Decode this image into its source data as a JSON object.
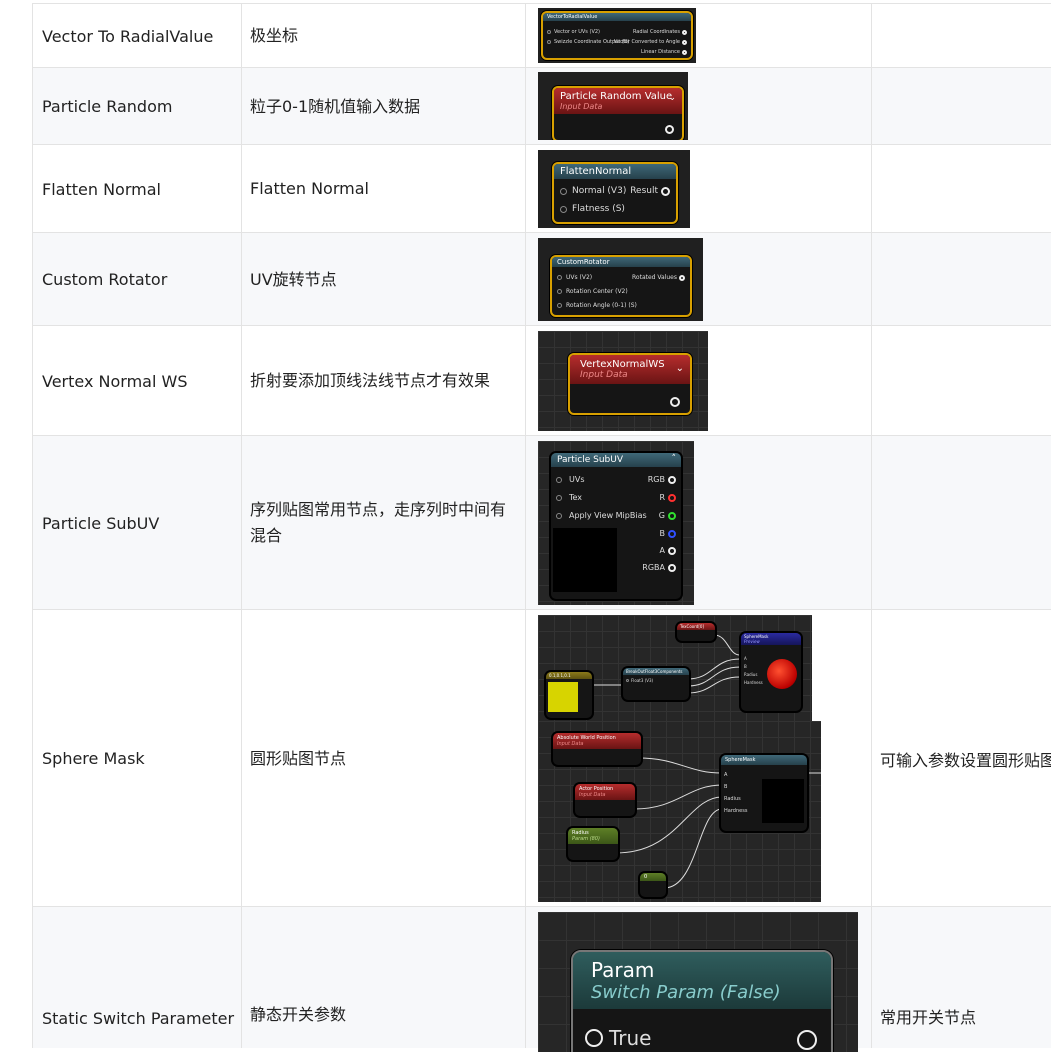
{
  "rows": [
    {
      "name": "Vector To RadialValue",
      "desc": "极坐标",
      "note": "",
      "node": {
        "title": "VectorToRadialValue",
        "pins_left": [
          "Vector or UVs (V2)",
          "Swizzle Coordinate Output (B)"
        ],
        "pins_right": [
          "Radial Coordinates",
          "Vector Converted to Angle",
          "Linear Distance"
        ]
      }
    },
    {
      "name": "Particle Random",
      "desc": "粒子0-1随机值输入数据",
      "note": "",
      "node": {
        "title": "Particle Random Value",
        "subtitle": "Input Data"
      }
    },
    {
      "name": "Flatten Normal",
      "desc": "Flatten Normal",
      "note": "",
      "node": {
        "title": "FlattenNormal",
        "pins_left": [
          "Normal (V3)",
          "Flatness (S)"
        ],
        "pins_right": [
          "Result"
        ]
      }
    },
    {
      "name": "Custom Rotator",
      "desc": "UV旋转节点",
      "note": "",
      "node": {
        "title": "CustomRotator",
        "pins_left": [
          "UVs (V2)",
          "Rotation Center (V2)",
          "Rotation Angle (0-1) (S)"
        ],
        "pins_right": [
          "Rotated Values"
        ]
      }
    },
    {
      "name": "Vertex Normal WS",
      "desc": "折射要添加顶线法线节点才有效果",
      "note": "",
      "node": {
        "title": "VertexNormalWS",
        "subtitle": "Input Data"
      }
    },
    {
      "name": "Particle SubUV",
      "desc": "序列贴图常用节点，走序列时中间有混合",
      "note": "",
      "node": {
        "title": "Particle SubUV",
        "pins_left": [
          "UVs",
          "Tex",
          "Apply View MipBias"
        ],
        "pins_right": [
          "RGB",
          "R",
          "G",
          "B",
          "A",
          "RGBA"
        ]
      }
    },
    {
      "name": "Sphere Mask",
      "desc": "圆形贴图节点",
      "note": "可输入参数设置圆形贴图",
      "node_top": {
        "const": "0.1,0.1,0.1",
        "texcoord": "TexCoord[0]",
        "breakout": "BreakOutFloat3Components",
        "breakout_pin": "Float3 (V3)",
        "sphere": "SphereMask",
        "sphere_sub": "Preview",
        "pins": [
          "A",
          "B",
          "Radius",
          "Hardness"
        ]
      },
      "node_bottom": {
        "awp": "Absolute World Position",
        "awp_sub": "Input Data",
        "actor": "Actor Position",
        "actor_sub": "Input Data",
        "radius": "Radius",
        "radius_sub": "Param (80)",
        "zero": "0",
        "sphere": "SphereMask",
        "pins": [
          "A",
          "B",
          "Radius",
          "Hardness"
        ]
      }
    },
    {
      "name": "Static Switch Parameter",
      "desc": "静态开关参数",
      "note": "常用开关节点",
      "node": {
        "title": "Param",
        "subtitle": "Switch Param (False)",
        "pin": "True"
      }
    }
  ],
  "colors": {
    "node_border": "#d8a000",
    "header_teal": "#3f6878",
    "header_red": "#b62d2d",
    "pin_red": "#ff3030",
    "pin_green": "#30e030",
    "pin_blue": "#3050ff"
  }
}
